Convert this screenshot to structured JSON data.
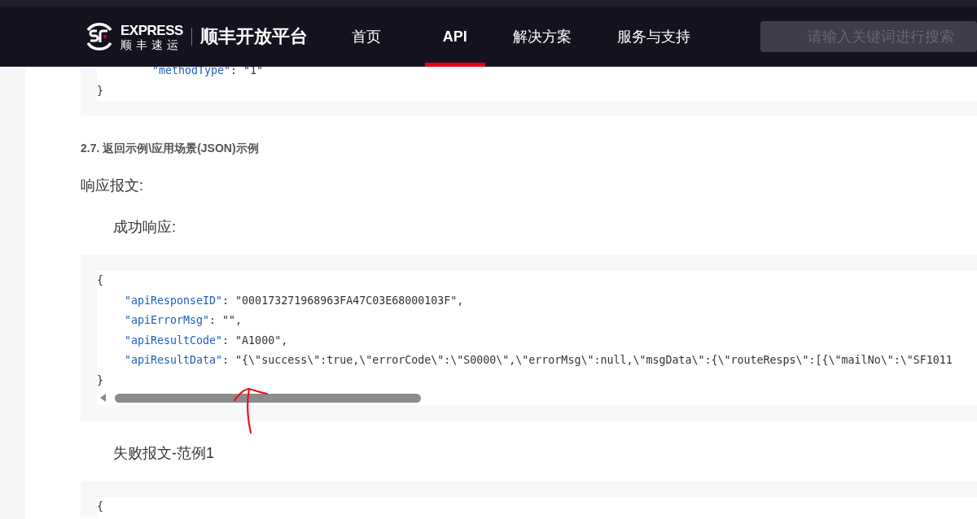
{
  "header": {
    "logo": {
      "wordmark": "EXPRESS",
      "brand": "顺丰速运",
      "platform": "顺丰开放平台"
    },
    "nav": [
      {
        "label": "首页",
        "selected": false
      },
      {
        "label": "API",
        "selected": true
      },
      {
        "label": "解决方案",
        "selected": false
      },
      {
        "label": "服务与支持",
        "selected": false
      }
    ],
    "search": {
      "placeholder": "请输入关键词进行搜索"
    }
  },
  "content": [
    {
      "kind": "code",
      "lines": [
        {
          "kind": "group",
          "children": [
            {
              "kind": "group",
              "children": [
                {
                  "kind": "pair",
                  "key": "\"methodType\"",
                  "rest": ": \"1\""
                }
              ]
            }
          ]
        },
        {
          "kind": "brace",
          "text": "}"
        }
      ]
    },
    {
      "kind": "section",
      "text": "2.7. 返回示例\\应用场景(JSON)示例"
    },
    {
      "kind": "label",
      "text": "响应报文:"
    },
    {
      "kind": "sublabel",
      "text": "成功响应:"
    },
    {
      "kind": "code",
      "scrollbar": true,
      "lines": [
        {
          "kind": "brace",
          "text": "{"
        },
        {
          "kind": "group",
          "children": [
            {
              "kind": "pair",
              "key": "\"apiResponseID\"",
              "rest": ": \"000173271968963FA47C03E68000103F\","
            },
            {
              "kind": "pair",
              "key": "\"apiErrorMsg\"",
              "rest": ": \"\","
            },
            {
              "kind": "pair",
              "key": "\"apiResultCode\"",
              "rest": ": \"A1000\","
            },
            {
              "kind": "pair",
              "key": "\"apiResultData\"",
              "rest": ": \"{\\\"success\\\":true,\\\"errorCode\\\":\\\"S0000\\\",\\\"errorMsg\\\":null,\\\"msgData\\\":{\\\"routeResps\\\":[{\\\"mailNo\\\":\\\"SF1011"
            }
          ]
        },
        {
          "kind": "brace",
          "text": "}"
        }
      ]
    },
    {
      "kind": "sublabel",
      "text": "失败报文-范例1"
    },
    {
      "kind": "code",
      "lines": [
        {
          "kind": "brace",
          "text": "{"
        }
      ]
    }
  ],
  "annotation": {
    "kind": "arrow"
  }
}
